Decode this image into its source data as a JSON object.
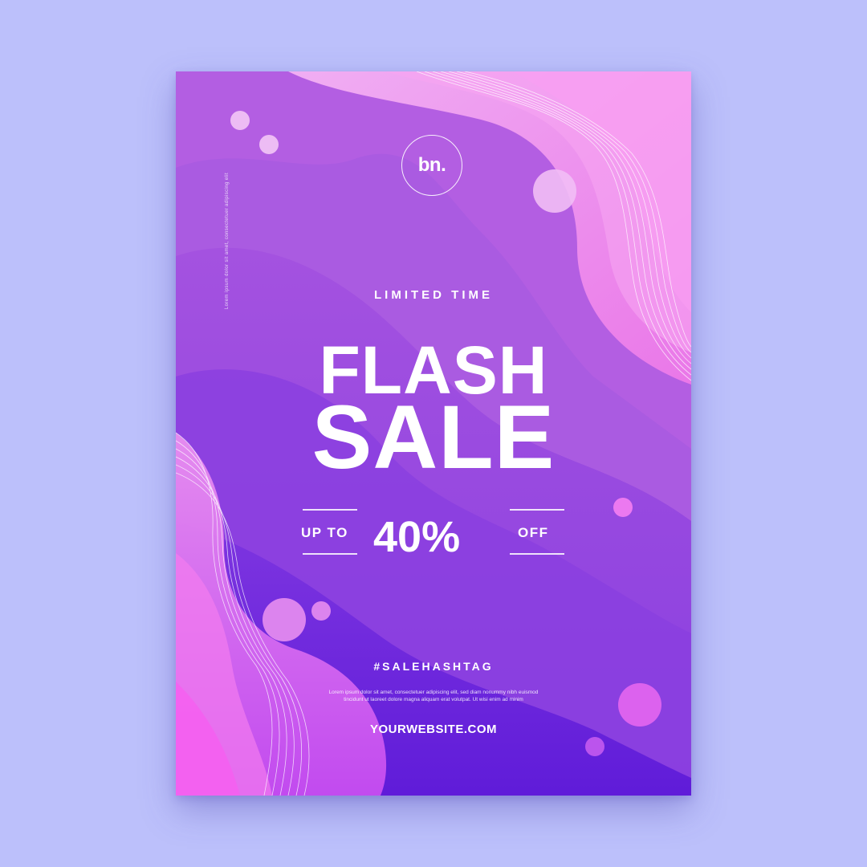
{
  "background_color": "#bcc0fb",
  "poster": {
    "logo_text": "bn.",
    "side_text": "Lorem ipsum dolor sit amet, consectetuer adipiscing elit",
    "eyebrow": "LIMITED TIME",
    "headline_line1": "FLASH",
    "headline_line2": "SALE",
    "offer_prefix": "UP TO",
    "offer_value": "40%",
    "offer_suffix": "OFF",
    "hashtag": "#SALEHASHTAG",
    "body_line1": "Lorem ipsum dolor sit amet, consectetuer adipiscing elit, sed diam nonummy nibh euismod",
    "body_line2": "tincidunt ut laoreet dolore magna aliquam erat volutpat. Ut wisi enim ad minim",
    "website": "YOURWEBSITE.COM",
    "colors": {
      "top": "#c466e3",
      "bottom": "#6a22de",
      "pink_accent": "#f27bf0",
      "text": "#ffffff"
    }
  }
}
